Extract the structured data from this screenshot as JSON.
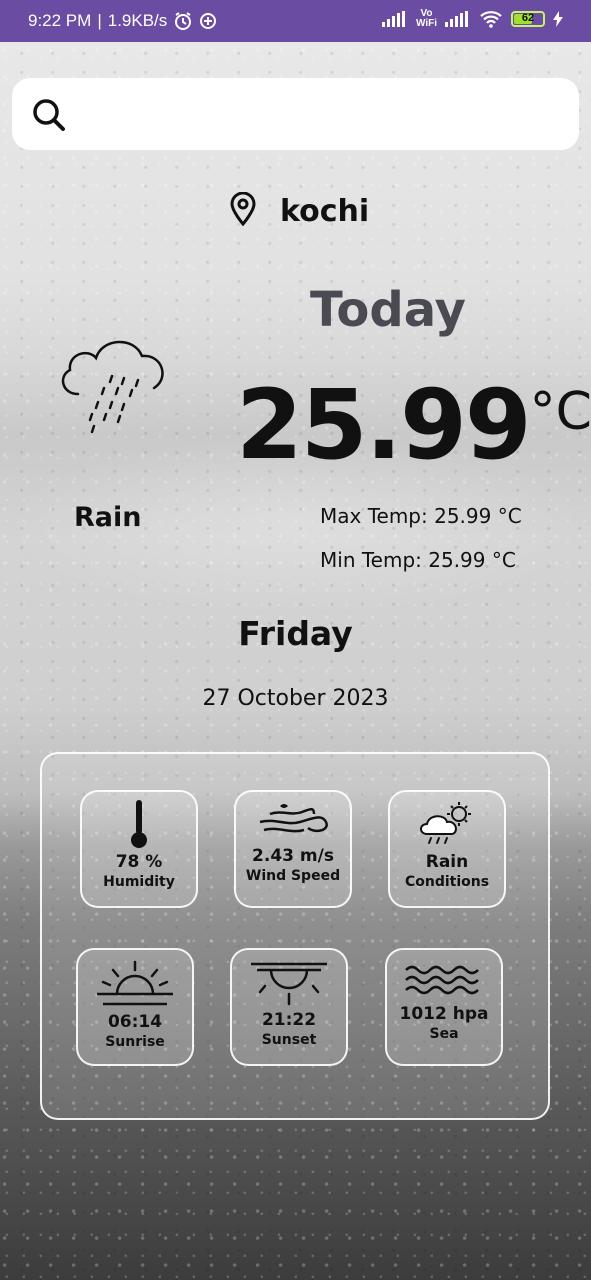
{
  "status_bar": {
    "time": "9:22 PM",
    "separator": "|",
    "speed": "1.9KB/s",
    "volte_top": "Vo",
    "volte_bottom": "WiFi",
    "battery": "62"
  },
  "search": {
    "placeholder": "",
    "value": ""
  },
  "location": {
    "city": "kochi"
  },
  "today_label": "Today",
  "weather": {
    "temperature": "25.99",
    "unit": "°C",
    "condition": "Rain",
    "max_temp": "Max Temp: 25.99 °C",
    "min_temp": "Min Temp: 25.99 °C",
    "day": "Friday",
    "date": "27 October 2023"
  },
  "details": [
    {
      "icon": "thermometer-icon",
      "value": "78 %",
      "label": "Humidity"
    },
    {
      "icon": "wind-icon",
      "value": "2.43 m/s",
      "label": "Wind Speed"
    },
    {
      "icon": "rain-sun-cloud-icon",
      "value": "Rain",
      "label": "Conditions"
    },
    {
      "icon": "sunrise-icon",
      "value": "06:14",
      "label": "Sunrise"
    },
    {
      "icon": "sunset-icon",
      "value": "21:22",
      "label": "Sunset"
    },
    {
      "icon": "waves-icon",
      "value": "1012 hpa",
      "label": "Sea"
    }
  ],
  "colors": {
    "status_bar": "#6a4ca3",
    "battery": "#9fe030",
    "today_text": "#4a4a52"
  }
}
